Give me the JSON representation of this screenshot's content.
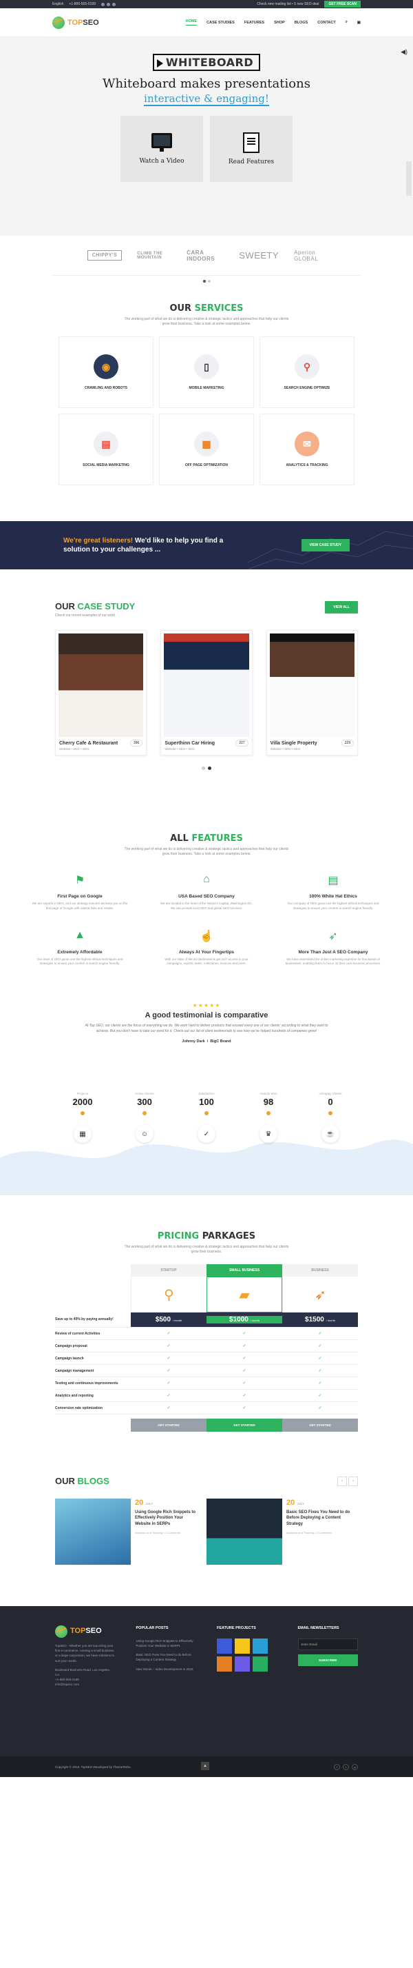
{
  "topbar": {
    "language": "English",
    "phone": "+1-800-555-0199",
    "message": "Check new mailing list • 5 new SEO deal",
    "cta": "GET FREE SCAN"
  },
  "header": {
    "brand_1": "TOP",
    "brand_2": "SEO",
    "nav": [
      "HOME",
      "CASE STUDIES",
      "FEATURES",
      "SHOP",
      "BLOGS",
      "CONTACT"
    ]
  },
  "hero": {
    "brand": "WHITEBOARD",
    "headline": "Whiteboard makes presentations",
    "subheadline": "interactive & engaging!",
    "cards": [
      {
        "label": "Watch a Video",
        "icon": "monitor-icon"
      },
      {
        "label": "Read Features",
        "icon": "document-icon"
      }
    ]
  },
  "clients": [
    "CHIPPY'S",
    "CLIMB THE MOUNTAIN",
    "CARA INDOORS",
    "SWEETY",
    "Aperion GLOBAL"
  ],
  "services": {
    "title_1": "OUR",
    "title_2": "SERVICES",
    "desc": "The working part of what we do is delivering creative & strategic tactics and approaches that help our clients grow their business. Take a look at some examples below.",
    "items": [
      {
        "label": "CRAWLING AND ROBOTS",
        "icon": "robot-icon"
      },
      {
        "label": "MOBILE MARKETING",
        "icon": "mobile-icon"
      },
      {
        "label": "SEARCH ENGINE OPTIMIZE",
        "icon": "search-icon"
      },
      {
        "label": "SOCIAL MEDIA MARKETING",
        "icon": "social-icon"
      },
      {
        "label": "OFF PAGE OPTIMIZATION",
        "icon": "page-icon"
      },
      {
        "label": "ANALYTICS & TRACKING",
        "icon": "analytics-icon"
      }
    ]
  },
  "cta": {
    "highlight": "We're great listeners!",
    "text": "We'd like to help you find a solution to your challenges ...",
    "button": "VIEW CASE STUDY"
  },
  "case_study": {
    "title_1": "OUR",
    "title_2": "CASE STUDY",
    "subtitle": "Check our recent examples of our work",
    "view_all": "VIEW ALL",
    "items": [
      {
        "title": "Cherry Cafe & Restaurant",
        "meta": "Website • SEO • SEO",
        "count": "396"
      },
      {
        "title": "Superthinn Car Hiring",
        "meta": "Website • SEO • SEO",
        "count": "227"
      },
      {
        "title": "Villa Single Property",
        "meta": "Website • SEO • SEO",
        "count": "229"
      }
    ]
  },
  "features": {
    "title_1": "ALL",
    "title_2": "FEATURES",
    "desc": "The working part of what we do is delivering creative & strategic tactics and approaches that help our clients grow their business. Take a look at some examples below.",
    "items": [
      {
        "title": "First Page on Google",
        "text": "We are experts in SEO, and our strategy ensures we keep you on the first page of Google with natural links and results.",
        "icon": "pin-icon"
      },
      {
        "title": "USA Based SEO Company",
        "text": "We are located in the heart of the Nation's Capital, Washington DC. We can provide local SEO and global SEO services.",
        "icon": "building-icon"
      },
      {
        "title": "100% White Hat Ethics",
        "text": "Our company of SEO gurus use the highest ethical techniques and strategies to ensure your content is search engine friendly.",
        "icon": "clipboard-icon"
      },
      {
        "title": "Extremely Affordable",
        "text": "Our team of SEO gurus use the highest ethical techniques and strategies to ensure your content is search engine friendly.",
        "icon": "chart-board-icon"
      },
      {
        "title": "Always At Your Fingertips",
        "text": "With our state of the art dashboard & get 24/7 access to your campaigns, reports, tasks, milestones, invoices and more.",
        "icon": "pointer-icon"
      },
      {
        "title": "More Than Just A SEO Company",
        "text": "We have assembled the online marketing expertise for thousands of businesses, enabling them to focus on their core business processes.",
        "icon": "rocket-icon"
      }
    ]
  },
  "testimonial": {
    "stars": "★★★★★",
    "title": "A good testimonial is comparative",
    "quote": "At Top SEO, our clients are the focus of everything we do. We work hard to deliver products that exceed every one of our clients' according to what they want to achieve. But you don't have to take our word for it. Check out our list of client testimonials to see how we've helped hundreds of companies grow!",
    "author": "Johnny Dark",
    "company": "BigC Brand"
  },
  "stats": [
    {
      "label": "Projects",
      "value": "2000",
      "icon": "briefcase-icon"
    },
    {
      "label": "Active Clients",
      "value": "300",
      "icon": "people-icon"
    },
    {
      "label": "Satisfaction",
      "value": "100",
      "icon": "thumb-icon"
    },
    {
      "label": "Awards Won",
      "value": "98",
      "icon": "trophy-icon"
    },
    {
      "label": "Unhappy Clients",
      "value": "0",
      "icon": "cup-icon"
    }
  ],
  "pricing": {
    "title_1": "PRICING",
    "title_2": "PARKAGES",
    "desc": "The working part of what we do is delivering creative & strategic tactics and approaches that help our clients grow their business.",
    "plans": [
      {
        "name": "STARTUP",
        "price": "$500",
        "per": "/ month",
        "icon": "bicycle-icon",
        "button": "GET STARTED"
      },
      {
        "name": "SMALL BUSINESS",
        "price": "$1000",
        "per": "/ month",
        "icon": "truck-icon",
        "button": "GET STARTED",
        "ribbon": "MOST POPULAR"
      },
      {
        "name": "BUSINESS",
        "price": "$1500",
        "per": "/ month",
        "icon": "rocket-icon",
        "button": "GET STARTED"
      }
    ],
    "price_label": "Save up to 40% by paying annually!",
    "check": "✓",
    "features": [
      "Review of current Activities",
      "Campaign proposal",
      "Campaign launch",
      "Campaign management",
      "Testing and continuous improvements",
      "Analytics and reporting",
      "Conversion rate optimization"
    ]
  },
  "blogs": {
    "title_1": "OUR",
    "title_2": "BLOGS",
    "items": [
      {
        "day": "20",
        "month": "JULY",
        "title": "Using Google Rich Snippets to Effectively Position Your Website in SERPs",
        "meta": "Analytics and Tracking | 0 Comments"
      },
      {
        "day": "20",
        "month": "JULY",
        "title": "Basic SEO Fixes You Need to do Before Deploying a Content Strategy",
        "meta": "Analytics and Tracking | 0 Comments"
      }
    ]
  },
  "footer": {
    "brand_1": "TOP",
    "brand_2": "SEO",
    "about": "TopSEO - Whether you are launching your first e-commerce, running a small business or a large corporation, we have solutions to suit your needs.",
    "address": "Boulevard Business Road, Los Angeles, CA",
    "phone": "+1-800-555-0199",
    "email": "info@topseo.com",
    "popular_title": "POPULAR POSTS",
    "popular": [
      "Using Google Rich Snippets to Effectively Position Your Website in SERPs",
      "Basic SEO Fixes You Need to do Before Deploying a Content Strategy",
      "New Words – Index Development in 2018"
    ],
    "projects_title": "FEATURE PROJECTS",
    "newsletter_title": "EMAIL NEWSLETTERS",
    "email_placeholder": "Enter Email",
    "subscribe": "SUBSCRIBE",
    "copyright": "Copyright © 2019. TopSEO Developed by ThemeTerbo"
  }
}
